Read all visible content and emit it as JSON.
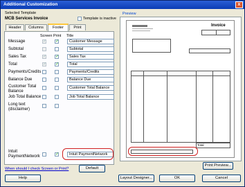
{
  "window": {
    "title": "Additional Customization",
    "close_glyph": "x"
  },
  "template": {
    "selected_label": "Selected Template",
    "name": "MCB Services Invoice",
    "inactive_label": "Template is inactive"
  },
  "tabs": [
    {
      "label": "Header"
    },
    {
      "label": "Columns"
    },
    {
      "label": "Footer"
    },
    {
      "label": "Print"
    }
  ],
  "footer_table": {
    "col_screen": "Screen",
    "col_print": "Print",
    "col_title": "Title",
    "rows": [
      {
        "label": "Message",
        "screen": true,
        "print": true,
        "title": "Customer Message"
      },
      {
        "label": "Subtotal",
        "screen": false,
        "print": false,
        "title": "Subtotal"
      },
      {
        "label": "Sales Tax",
        "screen": true,
        "print": true,
        "title": "Sales Tax"
      },
      {
        "label": "Total",
        "screen": true,
        "print": true,
        "title": "Total"
      },
      {
        "label": "Payments/Credits",
        "screen": false,
        "print": false,
        "title": "Payments/Credits"
      },
      {
        "label": "Balance Due",
        "screen": false,
        "print": false,
        "title": "Balance Due"
      },
      {
        "label": "Customer Total Balance",
        "screen": false,
        "print": false,
        "title": "Customer Total Balance"
      },
      {
        "label": "Job Total Balance",
        "screen": false,
        "print": false,
        "title": "Job Total Balance"
      },
      {
        "label": "Long text (disclaimer)",
        "screen": false,
        "print": false,
        "title": ""
      },
      {
        "label": "Intuit PaymentNetwork",
        "screen": false,
        "print": true,
        "title": "Intuit PaymentNetwork"
      }
    ],
    "check_glyph": "✓"
  },
  "preview": {
    "label": "Preview",
    "invoice_heading": "Invoice",
    "total_label": "Total",
    "print_preview_button": "Print Preview..."
  },
  "bottom": {
    "help_link": "When should I check Screen or Print?",
    "default_button": "Default",
    "help_button": "Help",
    "layout_designer_button": "Layout Designer...",
    "ok_button": "OK",
    "cancel_button": "Cancel"
  },
  "colors": {
    "highlight_oval": "#d02020",
    "check": "#21a121"
  }
}
